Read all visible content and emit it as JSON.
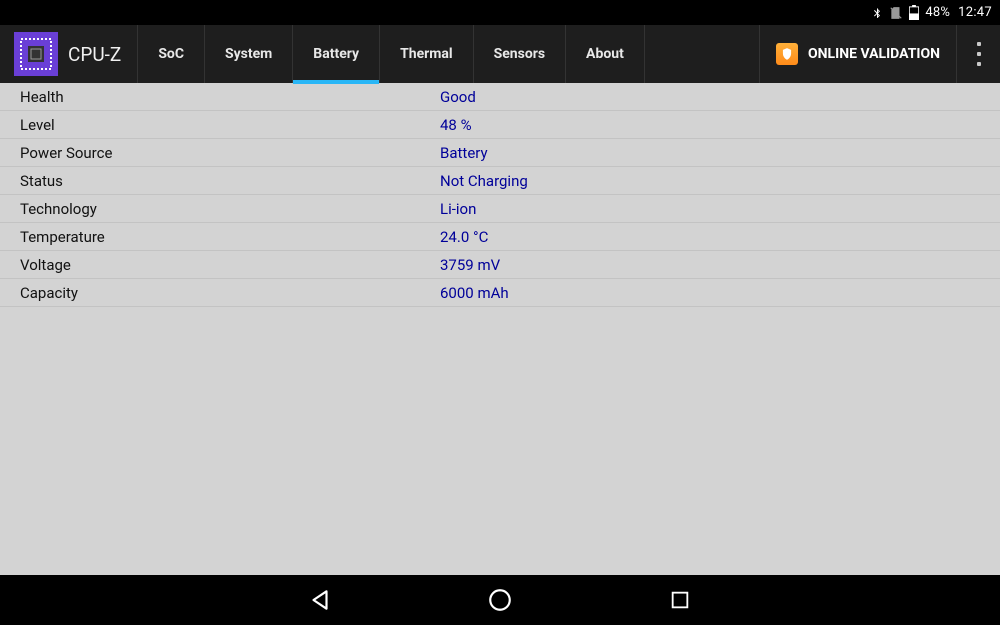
{
  "status_bar": {
    "battery_percent": "48%",
    "clock": "12:47"
  },
  "app": {
    "title": "CPU-Z"
  },
  "tabs": [
    {
      "label": "SoC",
      "active": false
    },
    {
      "label": "System",
      "active": false
    },
    {
      "label": "Battery",
      "active": true
    },
    {
      "label": "Thermal",
      "active": false
    },
    {
      "label": "Sensors",
      "active": false
    },
    {
      "label": "About",
      "active": false
    }
  ],
  "actions": {
    "online_validation": "ONLINE VALIDATION"
  },
  "rows": [
    {
      "label": "Health",
      "value": "Good"
    },
    {
      "label": "Level",
      "value": "48 %"
    },
    {
      "label": "Power Source",
      "value": "Battery"
    },
    {
      "label": "Status",
      "value": "Not Charging"
    },
    {
      "label": "Technology",
      "value": "Li-ion"
    },
    {
      "label": "Temperature",
      "value": "24.0 °C"
    },
    {
      "label": "Voltage",
      "value": "3759 mV"
    },
    {
      "label": "Capacity",
      "value": "6000 mAh"
    }
  ]
}
